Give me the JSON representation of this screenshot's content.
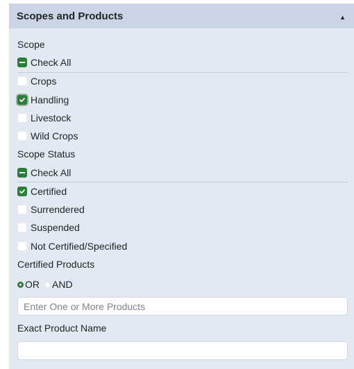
{
  "panel": {
    "title": "Scopes and Products",
    "collapse_icon": "caret-up-icon"
  },
  "scope": {
    "label": "Scope",
    "check_all": {
      "label": "Check All",
      "state": "indeterminate"
    },
    "options": [
      {
        "label": "Crops",
        "checked": false
      },
      {
        "label": "Handling",
        "checked": true
      },
      {
        "label": "Livestock",
        "checked": false
      },
      {
        "label": "Wild Crops",
        "checked": false
      }
    ]
  },
  "scope_status": {
    "label": "Scope Status",
    "check_all": {
      "label": "Check All",
      "state": "indeterminate"
    },
    "options": [
      {
        "label": "Certified",
        "checked": true
      },
      {
        "label": "Surrendered",
        "checked": false
      },
      {
        "label": "Suspended",
        "checked": false
      },
      {
        "label": "Not Certified/Specified",
        "checked": false
      }
    ]
  },
  "certified_products": {
    "label": "Certified Products",
    "match_options": [
      {
        "label": "OR",
        "selected": true
      },
      {
        "label": "AND",
        "selected": false
      }
    ],
    "input": {
      "value": "",
      "placeholder": "Enter One or More Products"
    }
  },
  "exact_product": {
    "label": "Exact Product Name",
    "input": {
      "value": "",
      "placeholder": ""
    }
  },
  "colors": {
    "panel_bg": "#e2e9f2",
    "header_bg": "#c9d5e5",
    "accent_green": "#2d7d3a"
  }
}
